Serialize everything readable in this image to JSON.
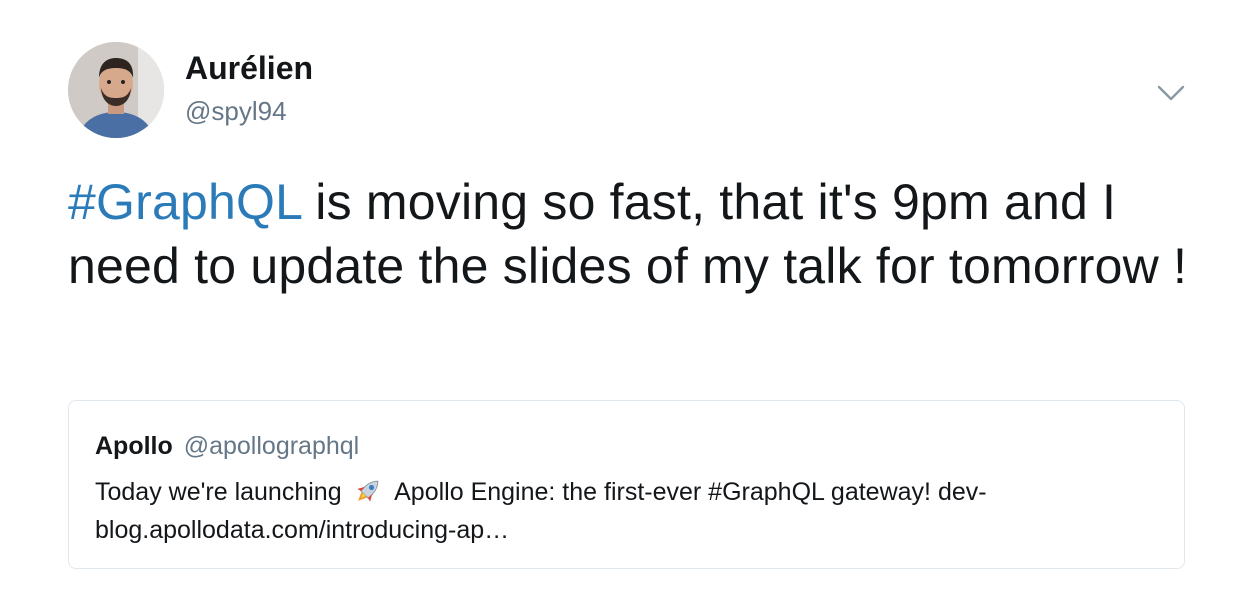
{
  "author": {
    "name": "Aurélien",
    "handle": "@spyl94",
    "avatar_icon": "avatar-photo-icon"
  },
  "menu": {
    "icon": "chevron-down-icon"
  },
  "tweet": {
    "hashtag": "#GraphQL",
    "text": " is moving so fast, that it's 9pm and I need to update the slides of my talk for tomorrow !"
  },
  "quoted_tweet": {
    "name": "Apollo",
    "handle": "@apollographql",
    "text_before": "Today we're launching",
    "emoji_icon": "rocket-icon",
    "text_after": " Apollo Engine: the first-ever #GraphQL gateway! dev-blog.apollodata.com/introducing-ap…"
  },
  "colors": {
    "link": "#2b7bb9",
    "secondary_text": "#657786",
    "border": "#e1e8ed"
  }
}
